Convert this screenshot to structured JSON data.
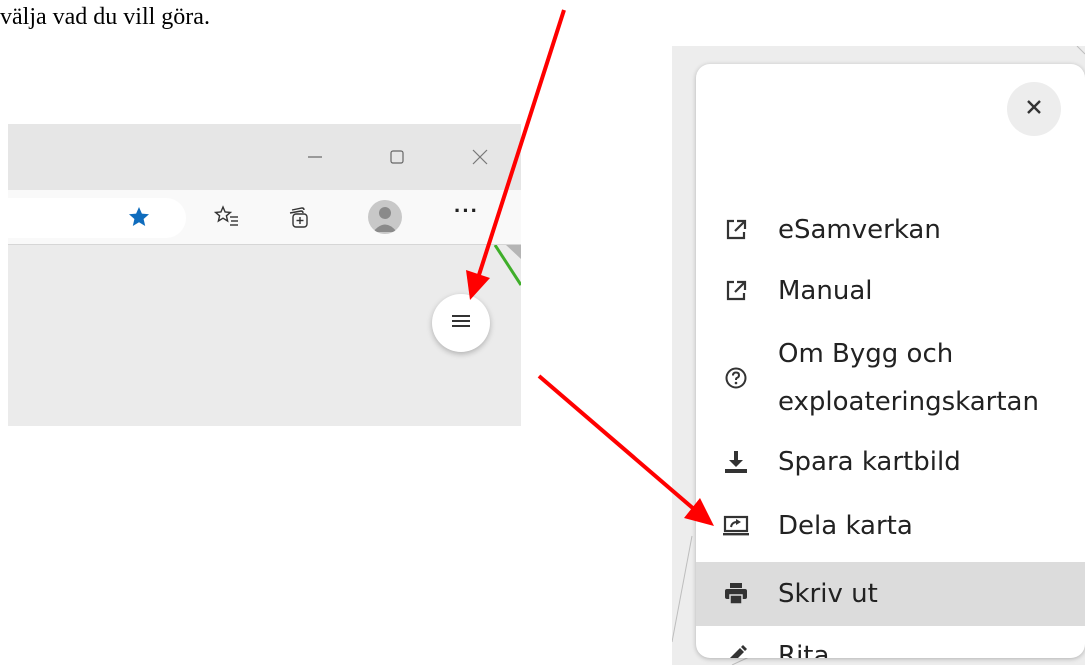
{
  "document": {
    "text": "välja vad du vill göra."
  },
  "browser": {
    "window_controls": {
      "minimize_icon": "minimize-icon",
      "maximize_icon": "maximize-icon",
      "close_icon": "close-icon"
    },
    "toolbar": {
      "favorite_icon": "star-icon",
      "favorites_icon": "favorites-list-icon",
      "collections_icon": "collections-icon",
      "profile_icon": "avatar-icon",
      "more_label": "···"
    },
    "map_menu_button_icon": "hamburger-icon"
  },
  "menu": {
    "close_icon": "close-icon",
    "items": [
      {
        "label": "eSamverkan",
        "icon": "external-link-icon"
      },
      {
        "label": "Manual",
        "icon": "external-link-icon"
      },
      {
        "label_line1": "Om Bygg och",
        "label_line2": "exploateringskartan",
        "icon": "help-circle-icon"
      },
      {
        "label": "Spara kartbild",
        "icon": "download-icon"
      },
      {
        "label": "Dela karta",
        "icon": "share-screen-icon"
      },
      {
        "label": "Skriv ut",
        "icon": "printer-icon",
        "highlighted": true
      },
      {
        "label": "Rita",
        "icon": "pencil-icon"
      }
    ]
  },
  "colors": {
    "arrow": "#ff0000",
    "favorite_star": "#0f6cbd",
    "menu_highlight": "#dcdcdc"
  }
}
